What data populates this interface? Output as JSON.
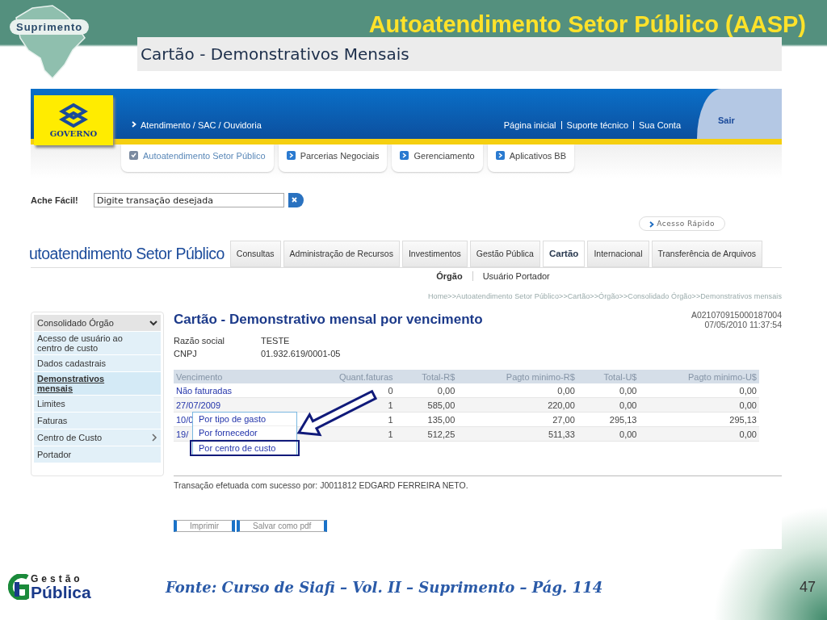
{
  "slide": {
    "badge": "Suprimento",
    "title": "Autoatendimento Setor Público (AASP)",
    "subtitle": "Cartão  - Demonstrativos Mensais",
    "source": "Fonte: Curso de Siafi – Vol. II – Suprimento – Pág. 114",
    "page_number": "47",
    "footer_logo": {
      "top": "Gestão",
      "bottom": "Pública"
    }
  },
  "site": {
    "logo_text": "GOVERNO",
    "top_link": "Atendimento / SAC / Ouvidoria",
    "header_links": [
      "Página inicial",
      "Suporte técnico",
      "Sua Conta"
    ],
    "exit": "Sair",
    "nav_tabs": [
      {
        "label": "Autoatendimento Setor Público",
        "selected": true
      },
      {
        "label": "Parcerias Negociais",
        "selected": false
      },
      {
        "label": "Gerenciamento",
        "selected": false
      },
      {
        "label": "Aplicativos BB",
        "selected": false
      }
    ],
    "search": {
      "label": "Ache Fácil!",
      "placeholder": "Digite transação desejada"
    },
    "quick_access": "Acesso Rápido",
    "section_title": "utoatendimento Setor Público",
    "section_tabs": [
      {
        "label": "Consultas",
        "selected": false
      },
      {
        "label": "Administração de Recursos",
        "selected": false
      },
      {
        "label": "Investimentos",
        "selected": false
      },
      {
        "label": "Gestão Pública",
        "selected": false
      },
      {
        "label": "Cartão",
        "selected": true
      },
      {
        "label": "Internacional",
        "selected": false
      },
      {
        "label": "Transferência de Arquivos",
        "selected": false
      }
    ],
    "sub_tabs": [
      {
        "label": "Órgão",
        "selected": true
      },
      {
        "label": "Usuário Portador",
        "selected": false
      }
    ],
    "breadcrumb": "Home>>Autoatendimento Setor Público>>Cartão>>Órgão>>Consolidado Órgão>>Demonstrativos mensais",
    "sidebar": {
      "items": [
        {
          "label": "Consolidado Órgão",
          "kind": "header",
          "selected": false
        },
        {
          "label": "Acesso de usuário ao centro de custo",
          "kind": "item",
          "selected": false
        },
        {
          "label": "Dados cadastrais",
          "kind": "item",
          "selected": false
        },
        {
          "label": "Demonstrativos mensais",
          "kind": "item",
          "selected": true
        },
        {
          "label": "Limites",
          "kind": "item",
          "selected": false
        },
        {
          "label": "Faturas",
          "kind": "item",
          "selected": false
        },
        {
          "label": "Centro de Custo",
          "kind": "submenu",
          "selected": false
        },
        {
          "label": "Portador",
          "kind": "item",
          "selected": false
        }
      ]
    },
    "content": {
      "title": "Cartão - Demonstrativo mensal por vencimento",
      "reference": "A021070915000187004",
      "timestamp": "07/05/2010 11:37:54",
      "fields": [
        {
          "label": "Razão social",
          "value": "TESTE"
        },
        {
          "label": "CNPJ",
          "value": "01.932.619/0001-05"
        }
      ],
      "table": {
        "columns": [
          "Vencimento",
          "Quant.faturas",
          "Total-R$",
          "Pagto minimo-R$",
          "Total-U$",
          "Pagto minimo-U$"
        ],
        "rows": [
          [
            "Não faturadas",
            "0",
            "0,00",
            "0,00",
            "0,00",
            "0,00"
          ],
          [
            "27/07/2009",
            "1",
            "585,00",
            "220,00",
            "0,00",
            "0,00"
          ],
          [
            "10/0",
            "1",
            "135,00",
            "27,00",
            "295,13",
            "295,13"
          ],
          [
            "19/",
            "1",
            "512,25",
            "511,33",
            "0,00",
            "0,00"
          ]
        ]
      },
      "popup_menu": [
        {
          "label": "Por tipo de gasto",
          "selected": false
        },
        {
          "label": "Por fornecedor",
          "selected": false
        },
        {
          "label": "Por centro de custo",
          "selected": true
        }
      ],
      "message": "Transação efetuada com sucesso por: J0011812 EDGARD FERREIRA NETO.",
      "buttons": [
        "Imprimir",
        "Salvar como pdf"
      ]
    }
  }
}
